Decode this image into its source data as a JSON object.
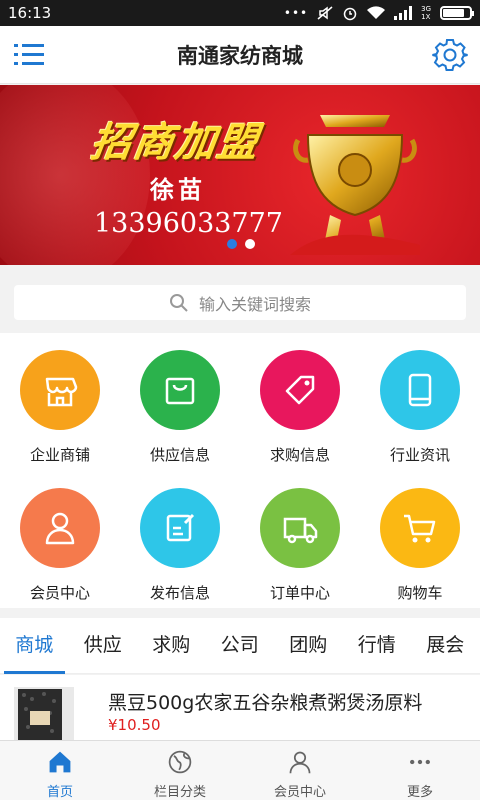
{
  "status_bar": {
    "time": "16:13",
    "dots": "•••",
    "net_type_top": "3G",
    "net_type_bottom": "1X",
    "battery_level": 0.85
  },
  "header": {
    "title": "南通家纺商城",
    "menu_icon": "menu-icon",
    "settings_icon": "gear-icon"
  },
  "banner": {
    "headline": "招商加盟",
    "name": "徐苗",
    "phone": "13396033777",
    "slide_count": 2,
    "active_slide": 0
  },
  "search": {
    "placeholder": "输入关键词搜索",
    "icon": "search-icon"
  },
  "grid": [
    {
      "label": "企业商铺",
      "color": "#f7a21b",
      "icon": "store-icon"
    },
    {
      "label": "供应信息",
      "color": "#2bb24c",
      "icon": "shopping-bag-icon"
    },
    {
      "label": "求购信息",
      "color": "#e8175d",
      "icon": "price-tag-icon"
    },
    {
      "label": "行业资讯",
      "color": "#2ec6e8",
      "icon": "tablet-icon"
    },
    {
      "label": "会员中心",
      "color": "#f57a4c",
      "icon": "user-icon"
    },
    {
      "label": "发布信息",
      "color": "#2ec6e8",
      "icon": "edit-icon"
    },
    {
      "label": "订单中心",
      "color": "#7ac142",
      "icon": "truck-icon"
    },
    {
      "label": "购物车",
      "color": "#fbb813",
      "icon": "cart-icon"
    }
  ],
  "tabs": [
    {
      "label": "商城",
      "active": true
    },
    {
      "label": "供应"
    },
    {
      "label": "求购"
    },
    {
      "label": "公司"
    },
    {
      "label": "团购"
    },
    {
      "label": "行情"
    },
    {
      "label": "展会"
    }
  ],
  "product": {
    "title": "黑豆500g农家五谷杂粮煮粥煲汤原料",
    "price": "¥10.50"
  },
  "bottom_nav": [
    {
      "label": "首页",
      "icon": "home-icon",
      "active": true
    },
    {
      "label": "栏目分类",
      "icon": "globe-icon"
    },
    {
      "label": "会员中心",
      "icon": "user-icon"
    },
    {
      "label": "更多",
      "icon": "more-icon"
    }
  ],
  "colors": {
    "accent": "#1f78d1",
    "price": "#e02020"
  }
}
